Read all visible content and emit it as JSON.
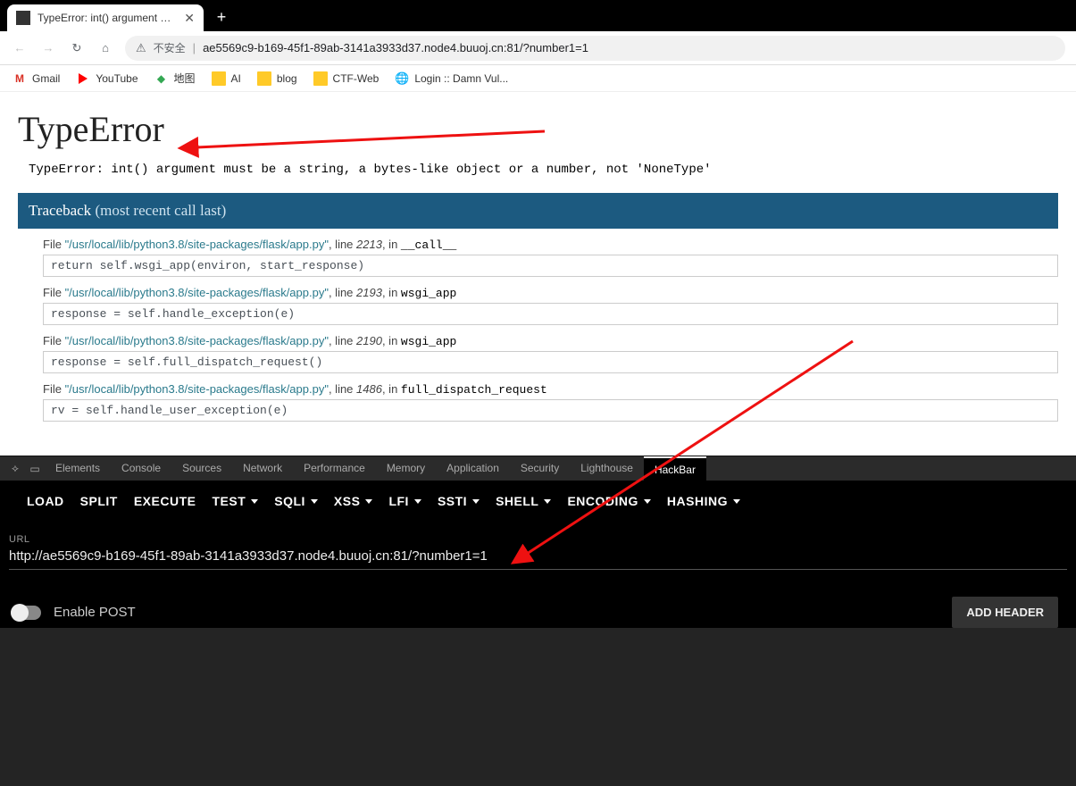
{
  "browser": {
    "tab_title": "TypeError: int() argument mus",
    "insecure_label": "不安全",
    "url_display": "ae5569c9-b169-45f1-89ab-3141a3933d37.node4.buuoj.cn:81/?number1=1",
    "bookmarks": [
      {
        "label": "Gmail",
        "icon": "gmail"
      },
      {
        "label": "YouTube",
        "icon": "youtube"
      },
      {
        "label": "地图",
        "icon": "maps"
      },
      {
        "label": "AI",
        "icon": "folder"
      },
      {
        "label": "blog",
        "icon": "folder"
      },
      {
        "label": "CTF-Web",
        "icon": "folder"
      },
      {
        "label": "Login :: Damn Vul...",
        "icon": "globe"
      }
    ]
  },
  "page": {
    "title": "TypeError",
    "error_text": "TypeError: int() argument must be a string, a bytes-like object or a number, not 'NoneType'",
    "tb_label": "Traceback",
    "tb_note": "(most recent call last)",
    "file_label": "File",
    "line_label": "line",
    "in_label": "in",
    "frames": [
      {
        "path": "\"/usr/local/lib/python3.8/site-packages/flask/app.py\"",
        "line": "2213",
        "fn": "__call__",
        "code": "return self.wsgi_app(environ, start_response)"
      },
      {
        "path": "\"/usr/local/lib/python3.8/site-packages/flask/app.py\"",
        "line": "2193",
        "fn": "wsgi_app",
        "code": "response = self.handle_exception(e)"
      },
      {
        "path": "\"/usr/local/lib/python3.8/site-packages/flask/app.py\"",
        "line": "2190",
        "fn": "wsgi_app",
        "code": "response = self.full_dispatch_request()"
      },
      {
        "path": "\"/usr/local/lib/python3.8/site-packages/flask/app.py\"",
        "line": "1486",
        "fn": "full_dispatch_request",
        "code": "rv = self.handle_user_exception(e)"
      }
    ]
  },
  "devtools": {
    "tabs": [
      "Elements",
      "Console",
      "Sources",
      "Network",
      "Performance",
      "Memory",
      "Application",
      "Security",
      "Lighthouse",
      "HackBar"
    ],
    "active_tab": "HackBar"
  },
  "hackbar": {
    "buttons": [
      "LOAD",
      "SPLIT",
      "EXECUTE"
    ],
    "menus": [
      "TEST",
      "SQLI",
      "XSS",
      "LFI",
      "SSTI",
      "SHELL",
      "ENCODING",
      "HASHING"
    ],
    "url_label": "URL",
    "url_value": "http://ae5569c9-b169-45f1-89ab-3141a3933d37.node4.buuoj.cn:81/?number1=1",
    "enable_post": "Enable POST",
    "add_header": "ADD HEADER"
  }
}
